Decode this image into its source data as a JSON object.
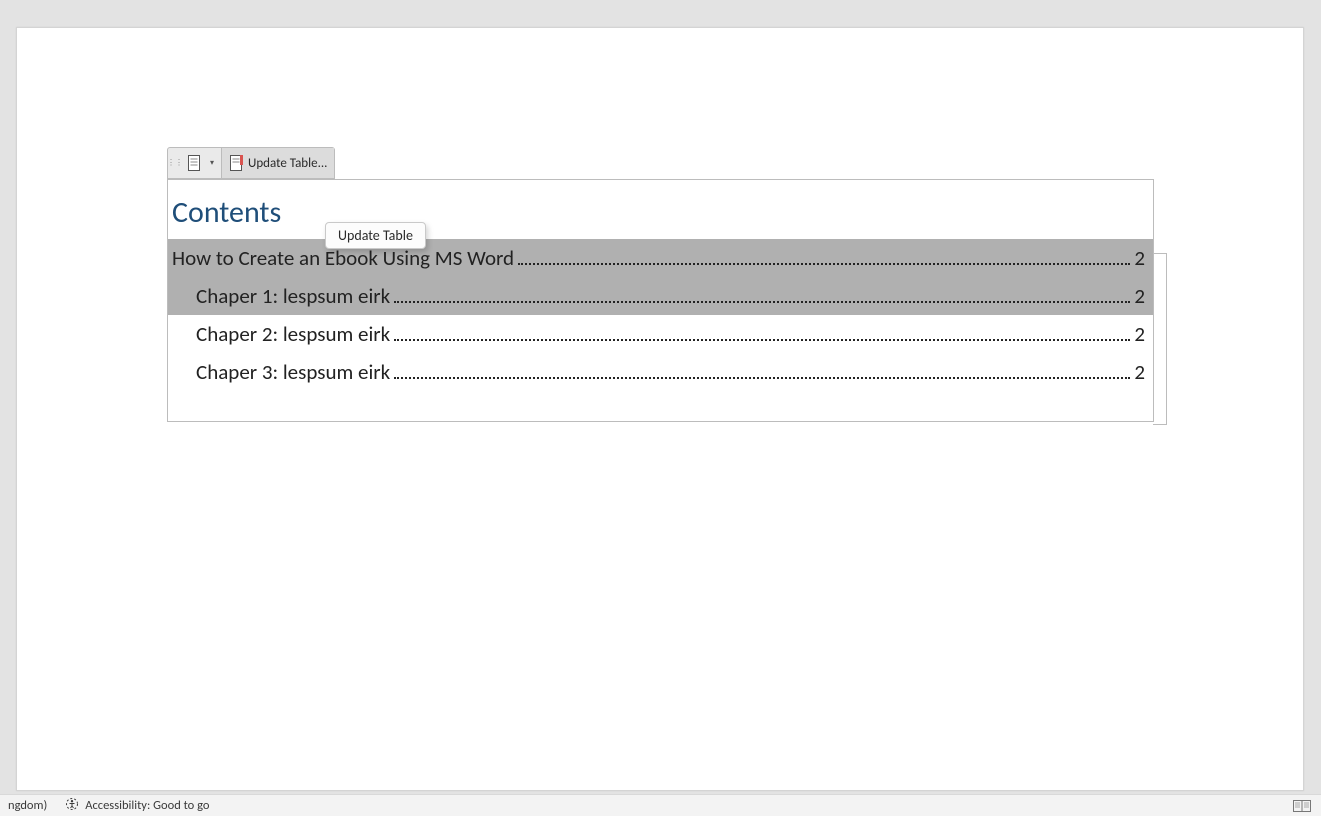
{
  "toolbar": {
    "update_label": "Update Table..."
  },
  "tooltip": "Update Table",
  "toc": {
    "title": "Contents",
    "entries": [
      {
        "text": "How to Create an Ebook Using MS Word",
        "page": "2",
        "level": 1,
        "highlight": true
      },
      {
        "text": "Chaper 1: lespsum eirk",
        "page": "2",
        "level": 2,
        "highlight": true
      },
      {
        "text": "Chaper 2: lespsum eirk",
        "page": "2",
        "level": 2,
        "highlight": false
      },
      {
        "text": "Chaper 3: lespsum eirk",
        "page": "2",
        "level": 2,
        "highlight": false
      }
    ]
  },
  "status": {
    "language_fragment": "ngdom)",
    "accessibility": "Accessibility: Good to go"
  }
}
